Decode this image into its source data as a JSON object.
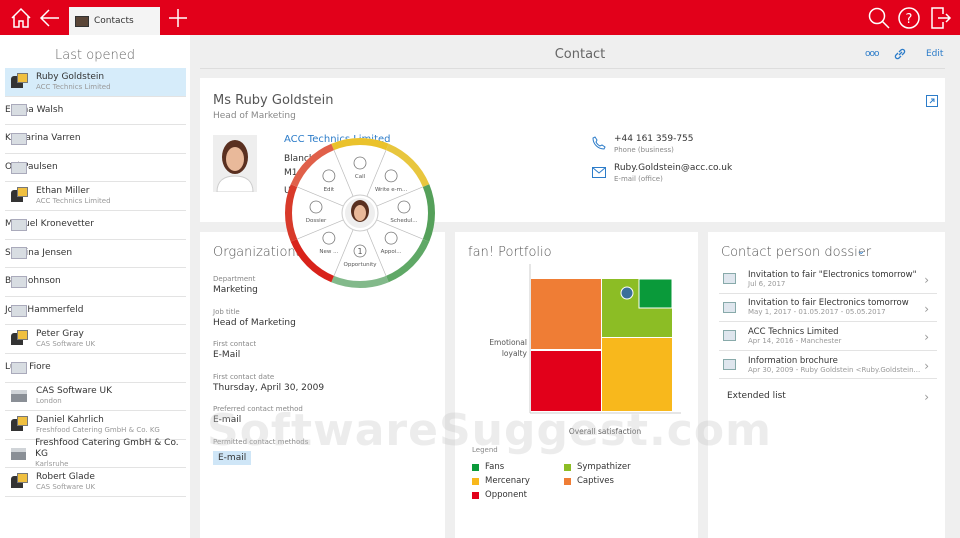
{
  "topbar": {
    "tab_label": "Contacts",
    "icons": [
      "home-icon",
      "back-arrow-icon",
      "plus-icon",
      "search-icon",
      "help-icon",
      "logout-icon"
    ]
  },
  "sidebar": {
    "title": "Last opened",
    "items": [
      {
        "name": "Ruby Goldstein",
        "sub": "ACC Technics Limited",
        "type": "person"
      },
      {
        "name": "Emma Walsh",
        "sub": "",
        "type": "card"
      },
      {
        "name": "Katharina Varren",
        "sub": "",
        "type": "card"
      },
      {
        "name": "Olé Paulsen",
        "sub": "",
        "type": "card"
      },
      {
        "name": "Ethan Miller",
        "sub": "ACC Technics Limited",
        "type": "person"
      },
      {
        "name": "Manuel Kronevetter",
        "sub": "",
        "type": "card"
      },
      {
        "name": "Sabrina Jensen",
        "sub": "",
        "type": "card"
      },
      {
        "name": "Ben Johnson",
        "sub": "",
        "type": "card"
      },
      {
        "name": "John Hammerfeld",
        "sub": "",
        "type": "card"
      },
      {
        "name": "Peter Gray",
        "sub": "CAS Software UK",
        "type": "person"
      },
      {
        "name": "Luigi Fiore",
        "sub": "",
        "type": "card"
      },
      {
        "name": "CAS Software UK",
        "sub": "London",
        "type": "company"
      },
      {
        "name": "Daniel Kahrlich",
        "sub": "Freshfood Catering GmbH & Co. KG",
        "type": "person"
      },
      {
        "name": "Freshfood Catering GmbH & Co. KG",
        "sub": "Karlsruhe",
        "type": "company"
      },
      {
        "name": "Robert Glade",
        "sub": "CAS Software UK",
        "type": "person"
      }
    ]
  },
  "header": {
    "title": "Contact",
    "more": "ooo",
    "edit": "Edit"
  },
  "contact": {
    "name": "Ms Ruby Goldstein",
    "position": "Head of Marketing",
    "company": "ACC Technics Limited",
    "address": [
      "Blanch",
      "M1",
      "U"
    ],
    "phone": "+44 161 359-755",
    "phone_label": "Phone (business)",
    "email": "Ruby.Goldstein@acc.co.uk",
    "email_label": "E-mail (office)"
  },
  "radial_menu": {
    "items": [
      "Call",
      "Write e-m...",
      "Schedul...",
      "Appoi...",
      "Opportunity",
      "New ...",
      "Dossier",
      "Edit"
    ],
    "opportunity_count": "1"
  },
  "org": {
    "title": "Organizational",
    "fields": [
      {
        "label": "Department",
        "value": "Marketing"
      },
      {
        "label": "Job title",
        "value": "Head of Marketing"
      },
      {
        "label": "First contact",
        "value": "E-Mail"
      },
      {
        "label": "First contact date",
        "value": "Thursday, April 30, 2009"
      },
      {
        "label": "Preferred contact method",
        "value": "E-mail"
      }
    ],
    "permitted_label": "Permitted contact methods",
    "permitted_value": "E-mail"
  },
  "portfolio": {
    "title": "fan! Portfolio",
    "ylabel": "Emotional loyalty",
    "xlabel": "Overall satisfaction",
    "legend_title": "Legend",
    "legend": [
      {
        "name": "Fans",
        "color": "#0a9a3a"
      },
      {
        "name": "Sympathizer",
        "color": "#8cbd25"
      },
      {
        "name": "Mercenary",
        "color": "#f8b81c"
      },
      {
        "name": "Captives",
        "color": "#ef7d35"
      },
      {
        "name": "Opponent",
        "color": "#e2001a"
      }
    ]
  },
  "dossier": {
    "title": "Contact person dossier",
    "items": [
      {
        "title": "Invitation to fair \"Electronics tomorrow\"",
        "sub": "Jul 6, 2017",
        "icon": "word-document-icon"
      },
      {
        "title": "Invitation to fair Electronics tomorrow",
        "sub": "May 1, 2017 - 01.05.2017 - 05.05.2017",
        "icon": "campaign-icon"
      },
      {
        "title": "ACC Technics Limited",
        "sub": "Apr 14, 2016 - Manchester",
        "icon": "address-card-icon"
      },
      {
        "title": "Information brochure",
        "sub": "Apr 30, 2009 - Ruby Goldstein <Ruby.Goldstein...",
        "icon": "email-icon"
      }
    ],
    "extended": "Extended list"
  },
  "watermark": "SoftwareSuggest.com"
}
